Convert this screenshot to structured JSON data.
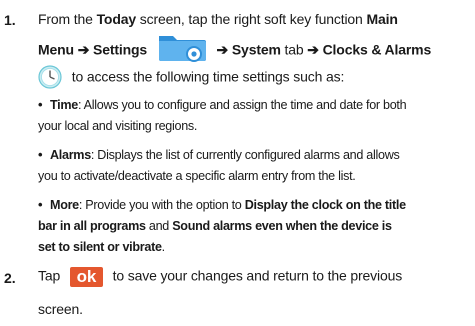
{
  "steps": [
    {
      "number": "1.",
      "lines": {
        "l1": {
          "a": "From the ",
          "b": "Today",
          "c": " screen, tap the right soft key function ",
          "d": "Main"
        },
        "l2": {
          "a": "Menu ➔ Settings",
          "b": "➔ System",
          "c": " tab ",
          "d": "➔ Clocks & Alarms"
        },
        "l3": {
          "a": " to access the following time settings such as:"
        }
      },
      "bullets": [
        {
          "bullet": "•",
          "title": "Time",
          "line1": ": Allows you to configure and assign the time and date for both",
          "line2": "your local and visiting regions."
        },
        {
          "bullet": "•",
          "title": "Alarms",
          "line1": ": Displays the list of currently configured alarms and allows",
          "line2": "you to activate/deactivate a specific alarm entry from the list."
        },
        {
          "bullet": "•",
          "title": "More",
          "line1a": ": Provide you with the option to ",
          "line1b": "Display the clock on the title",
          "line2a": "bar in all programs",
          "line2b": " and ",
          "line2c": "Sound alarms even when the device is",
          "line3a": "set to silent or vibrate",
          "line3b": "."
        }
      ]
    },
    {
      "number": "2.",
      "line1a": "Tap ",
      "button_label": "ok",
      "line1b": " to save your changes and return to the previous",
      "line2": "screen."
    }
  ],
  "icons": {
    "settings": "settings-folder-icon",
    "clock": "clock-icon"
  },
  "colors": {
    "ok_button": "#e4572e",
    "folder": "#2f8fd8",
    "text": "#1a1a1a"
  }
}
